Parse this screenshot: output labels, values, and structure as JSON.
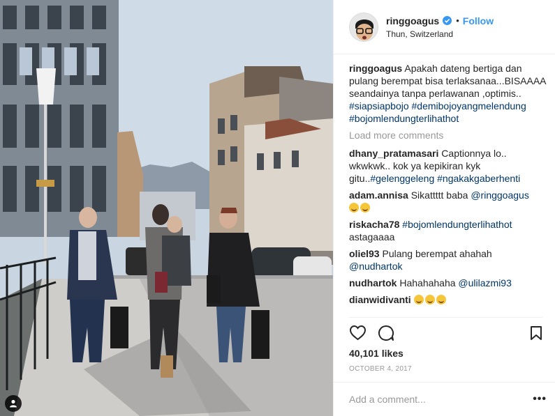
{
  "post": {
    "username": "ringgoagus",
    "follow_label": "Follow",
    "dot": "•",
    "location": "Thun, Switzerland",
    "caption": {
      "username": "ringgoagus",
      "text": "Apakah dateng bertiga dan pulang berempat bisa terlaksanaa...BISAAAA seandainya tanpa perlawanan ,optimis..",
      "hashtags": [
        "#siapsiapbojo",
        "#demibojoyangmelendung",
        "#bojomlendungterlihathot"
      ]
    },
    "load_more_label": "Load more comments",
    "comments": [
      {
        "user": "dhany_pratamasari",
        "text": "Captionnya lo.. wkwkwk.. kok ya kepikiran kyk gitu..",
        "hashtags": "#gelenggeleng #ngakakgaberhenti"
      },
      {
        "user": "adam.annisa",
        "text": "Sikattttt baba",
        "mention": "@ringgoagus",
        "emoji_count": 2
      },
      {
        "user": "riskacha78",
        "hashtags": "#bojomlendungterlihathot",
        "text2": "astagaaaa"
      },
      {
        "user": "oliel93",
        "text": "Pulang berempat ahahah",
        "mention": "@nudhartok"
      },
      {
        "user": "nudhartok",
        "text": "Hahahahaha",
        "mention": "@ulilazmi93"
      },
      {
        "user": "dianwidivanti",
        "emoji_count": 3
      }
    ],
    "likes": "40,101 likes",
    "date": "OCTOBER 4, 2017",
    "add_comment_placeholder": "Add a comment...",
    "more_label": "•••",
    "icons": {
      "verified": "verified-badge-icon",
      "like": "heart-icon",
      "comment": "comment-bubble-icon",
      "save": "bookmark-icon",
      "user_tag": "person-tag-icon"
    },
    "colors": {
      "link_blue": "#3897f0",
      "hashtag": "#003569",
      "muted": "#999999",
      "text": "#262626"
    }
  }
}
